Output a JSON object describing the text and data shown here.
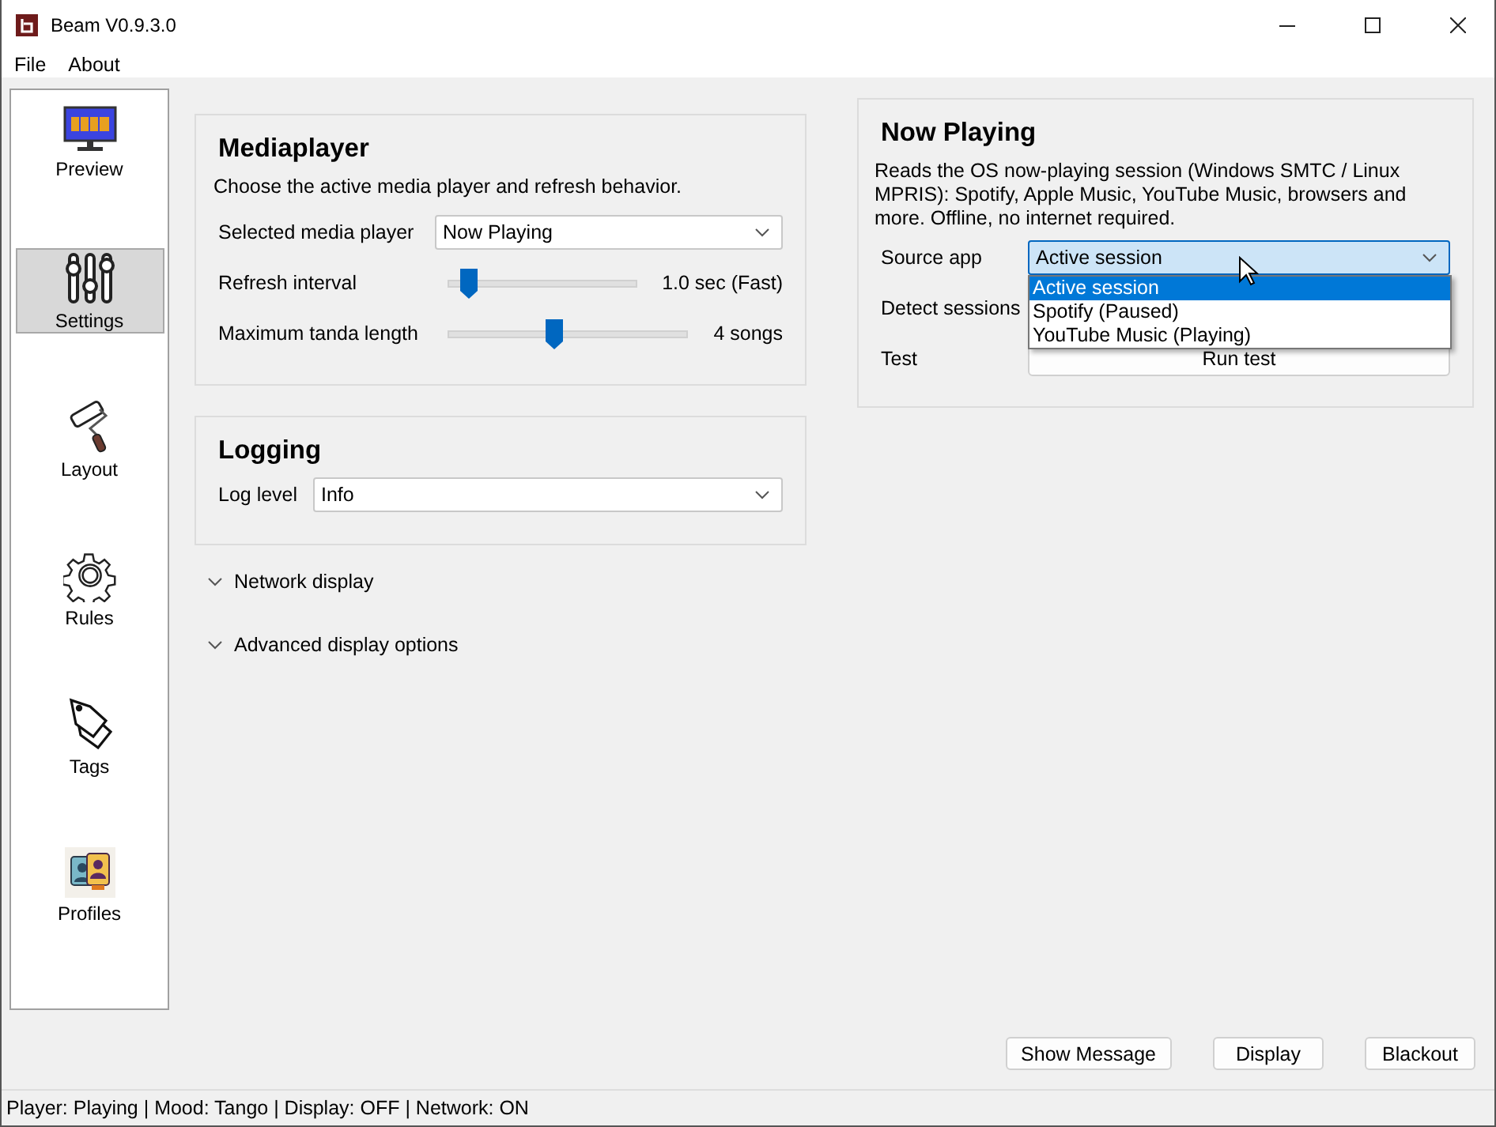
{
  "window": {
    "title": "Beam V0.9.3.0"
  },
  "menu": [
    "File",
    "About"
  ],
  "sidebar": {
    "items": [
      {
        "label": "Preview",
        "selected": false
      },
      {
        "label": "Settings",
        "selected": true
      },
      {
        "label": "Layout",
        "selected": false
      },
      {
        "label": "Rules",
        "selected": false
      },
      {
        "label": "Tags",
        "selected": false
      },
      {
        "label": "Profiles",
        "selected": false
      }
    ]
  },
  "mediaplayer": {
    "title": "Mediaplayer",
    "description": "Choose the active media player and refresh behavior.",
    "rows": [
      {
        "kind": "select",
        "label": "Selected media player",
        "value": "Now Playing"
      },
      {
        "kind": "slider",
        "label": "Refresh interval",
        "level": 0.07,
        "reading": "1.0 sec (Fast)"
      },
      {
        "kind": "slider",
        "label": "Maximum tanda length",
        "level": 0.41,
        "reading": "4 songs"
      }
    ]
  },
  "logging": {
    "title": "Logging",
    "rows": [
      {
        "kind": "select",
        "label": "Log level",
        "value": "Info"
      }
    ]
  },
  "sections": [
    "Network display",
    "Advanced display options"
  ],
  "now_playing": {
    "title": "Now Playing",
    "description": "Reads the OS now-playing session (Windows SMTC / Linux MPRIS): Spotify, Apple Music, YouTube Music, browsers and more. Offline, no internet required.",
    "rows": [
      {
        "kind": "select",
        "label": "Source app",
        "value": "Active session",
        "open": true,
        "options": [
          {
            "label": "Active session",
            "selected": true
          },
          {
            "label": "Spotify (Paused)",
            "selected": false
          },
          {
            "label": "YouTube Music (Playing)",
            "selected": false
          }
        ]
      },
      {
        "kind": "hidden",
        "label": "Detect sessions"
      },
      {
        "kind": "button",
        "label": "Test",
        "button": "Run test"
      }
    ]
  },
  "buttons": [
    "Show Message",
    "Display",
    "Blackout"
  ],
  "status_bar": "Player: Playing | Mood: Tango | Display: OFF | Network: ON"
}
